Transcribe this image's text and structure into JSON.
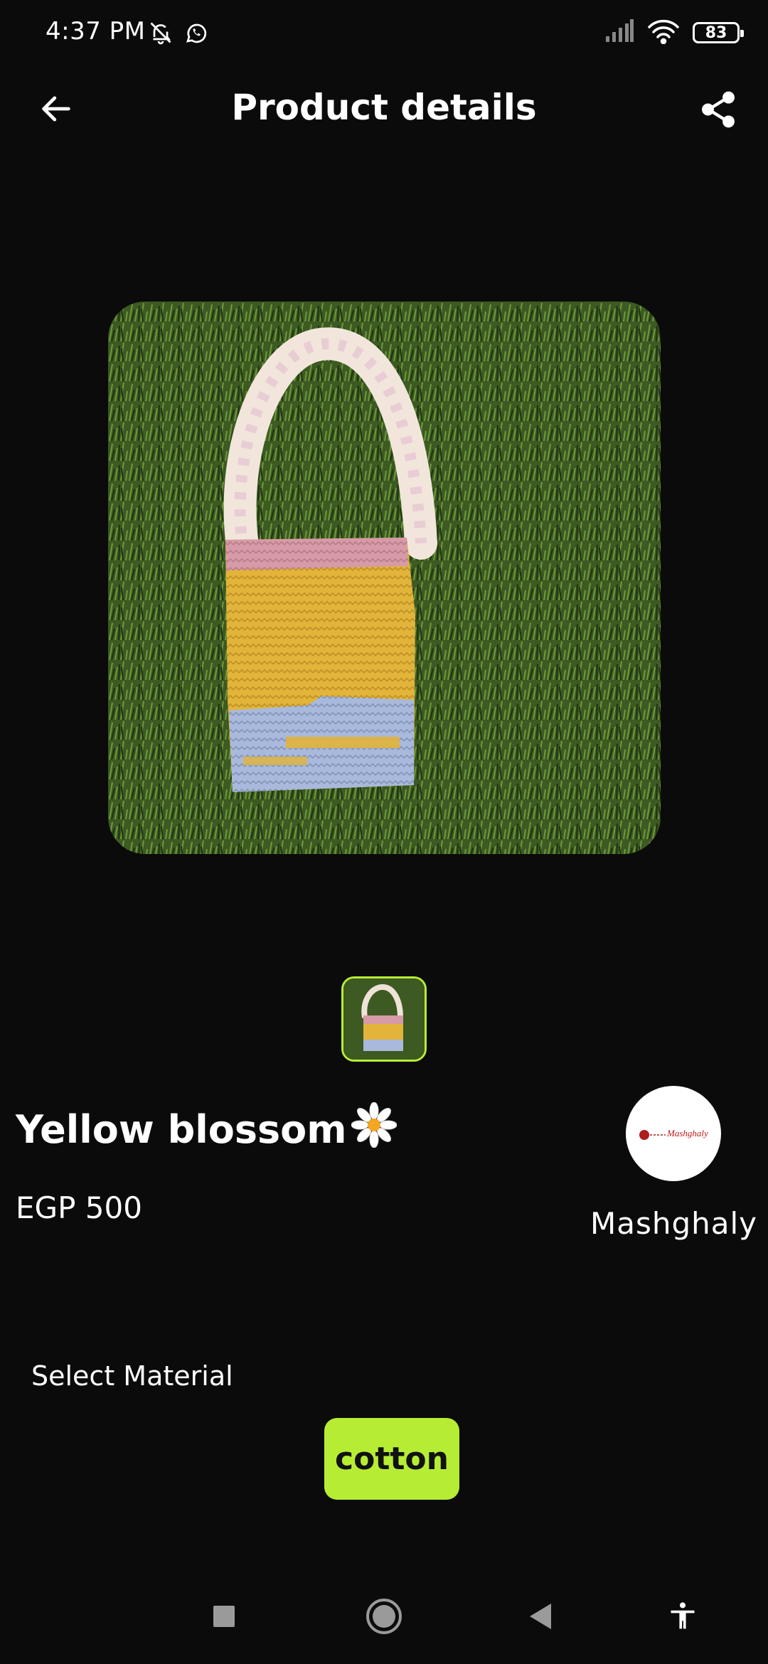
{
  "status_bar": {
    "time": "4:37 PM",
    "battery": "83",
    "icons": [
      "bell-off-icon",
      "whatsapp-icon",
      "signal-icon",
      "wifi-icon",
      "battery-icon"
    ]
  },
  "app_bar": {
    "title": "Product details",
    "back_icon": "arrow-left-icon",
    "share_icon": "share-icon"
  },
  "product": {
    "name": "Yellow blossom",
    "name_emoji": "🌼",
    "price": "EGP 500",
    "seller": "Mashghaly",
    "seller_logo_text": "Mashghaly"
  },
  "material": {
    "label": "Select Material",
    "options": [
      "cotton"
    ],
    "selected": "cotton"
  },
  "colors": {
    "accent": "#B7EC35",
    "background": "#0B0B0B"
  },
  "nav_bar": {
    "items": [
      "recents-button",
      "home-button",
      "back-button",
      "accessibility-button"
    ]
  }
}
